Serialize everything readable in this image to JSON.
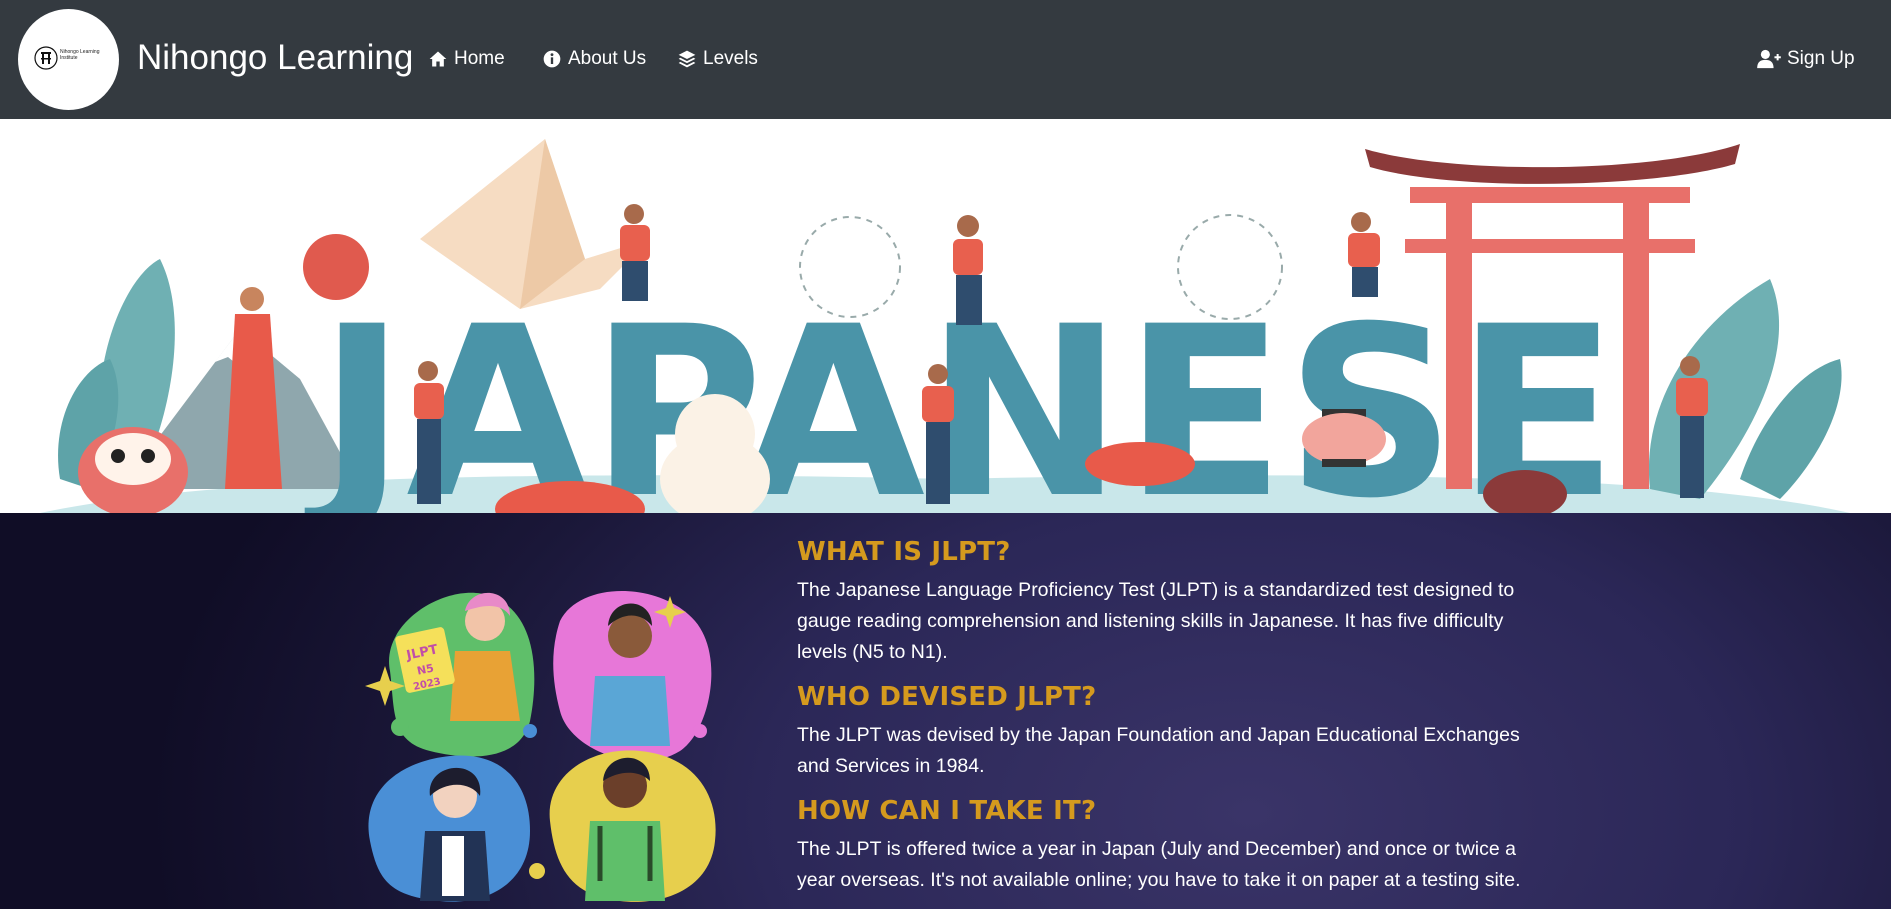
{
  "navbar": {
    "logo_text": "Nihongo Learning Institute",
    "brand": "Nihongo Learning",
    "links": [
      {
        "label": "Home",
        "icon": "home-icon"
      },
      {
        "label": "About Us",
        "icon": "info-circle-icon"
      },
      {
        "label": "Levels",
        "icon": "layers-icon"
      }
    ],
    "signup": {
      "label": "Sign Up",
      "icon": "user-plus-icon"
    }
  },
  "banner": {
    "word": "JAPANESE"
  },
  "illustration": {
    "badge_text": "JLPT",
    "badge_level": "N5",
    "badge_year": "2023"
  },
  "sections": [
    {
      "heading": "WHAT IS JLPT?",
      "text": "The Japanese Language Proficiency Test (JLPT) is a standardized test designed to gauge reading comprehension and listening skills in Japanese. It has five difficulty levels (N5 to N1)."
    },
    {
      "heading": "WHO DEVISED JLPT?",
      "text": "The JLPT was devised by the Japan Foundation and Japan Educational Exchanges and Services in 1984."
    },
    {
      "heading": "HOW CAN I TAKE IT?",
      "text": "The JLPT is offered twice a year in Japan (July and December) and once or twice a year overseas. It's not available online; you have to take it on paper at a testing site."
    }
  ],
  "colors": {
    "navbar_bg": "#343a40",
    "heading_accent": "#d59a1e",
    "letters_teal": "#4a94a8",
    "torii_red": "#e8706a"
  }
}
